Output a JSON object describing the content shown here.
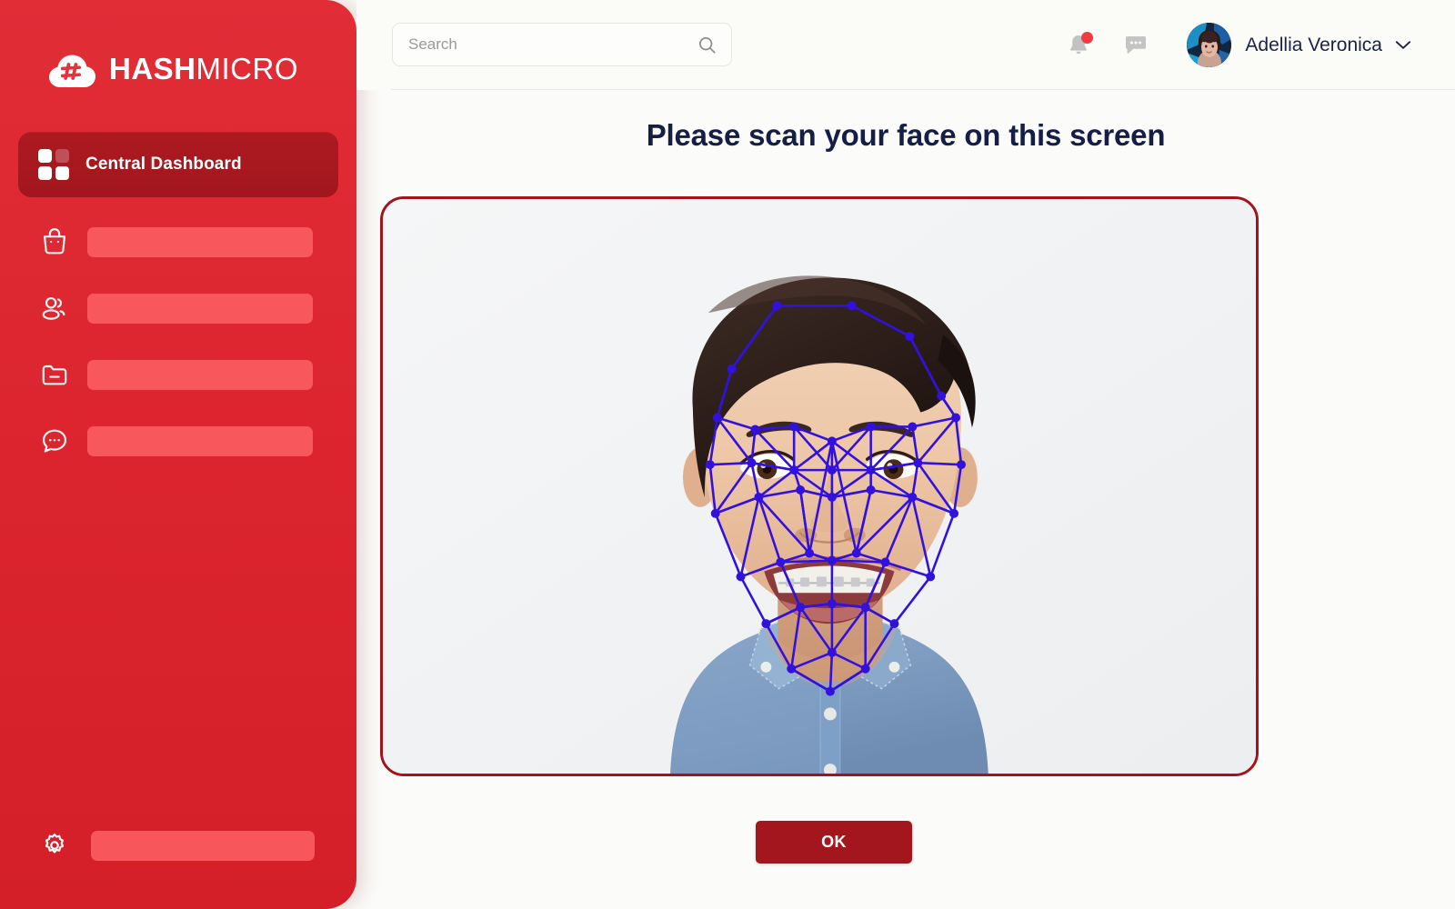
{
  "brand": {
    "name_bold": "HASH",
    "name_light": "MICRO",
    "logo_icon": "cloud-hash-logo-icon"
  },
  "sidebar": {
    "background_color": "#dc252f",
    "active_item": {
      "label": "Central Dashboard",
      "icon": "grid-dashboard-icon",
      "background_color": "#a8181f"
    },
    "items": [
      {
        "icon": "shopping-bag-icon",
        "label": ""
      },
      {
        "icon": "users-group-icon",
        "label": ""
      },
      {
        "icon": "folder-minus-icon",
        "label": ""
      },
      {
        "icon": "chat-bubble-dots-icon",
        "label": ""
      }
    ],
    "bottom_item": {
      "icon": "gear-settings-icon",
      "label": ""
    }
  },
  "header": {
    "search": {
      "placeholder": "Search",
      "value": "",
      "icon": "search-icon"
    },
    "notifications": {
      "icon": "bell-icon",
      "has_unread": true,
      "badge_color": "#ef3b41"
    },
    "messages": {
      "icon": "chat-bubble-icon"
    },
    "user": {
      "name": "Adellia Veronica",
      "avatar_icon": "user-avatar",
      "chevron_icon": "chevron-down-icon"
    }
  },
  "main": {
    "title": "Please scan your face on this screen",
    "title_color": "#151f45",
    "camera": {
      "border_color": "#a4131b",
      "background_color": "#f2f3f5",
      "subject": "man-in-denim-shirt-smiling-with-braces",
      "face_mesh": {
        "color": "#3311dd",
        "node_count": 48,
        "description": "face-recognition-mesh-overlay"
      }
    },
    "ok_button": {
      "label": "OK",
      "background_color": "#a4161e",
      "text_color": "#ffffff"
    }
  }
}
